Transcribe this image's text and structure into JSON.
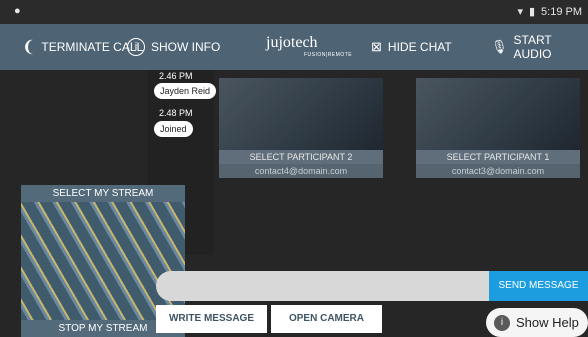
{
  "status": {
    "time": "5:19 PM",
    "left_icon": "android-icon",
    "wifi": "wifi-icon",
    "battery": "battery-icon"
  },
  "toolbar": {
    "terminate": "TERMINATE CALL",
    "show_info": "SHOW INFO",
    "logo": "jujotech",
    "logo_sub": "FUSION|REMOTE",
    "hide_chat": "HIDE CHAT",
    "start_audio": "START AUDIO"
  },
  "chat": {
    "messages": [
      {
        "time": "2.46 PM",
        "text": "Jayden Reid"
      },
      {
        "time": "2.48 PM",
        "text": "Joined"
      }
    ]
  },
  "participants": [
    {
      "label": "SELECT PARTICIPANT 2",
      "contact": "contact4@domain.com"
    },
    {
      "label": "SELECT PARTICIPANT 1",
      "contact": "contact3@domain.com"
    }
  ],
  "my_stream": {
    "select": "SELECT MY STREAM",
    "stop": "STOP MY STREAM"
  },
  "composer": {
    "placeholder": "",
    "send": "SEND MESSAGE"
  },
  "buttons": {
    "write": "WRITE MESSAGE",
    "camera": "OPEN CAMERA",
    "help": "Show Help"
  }
}
